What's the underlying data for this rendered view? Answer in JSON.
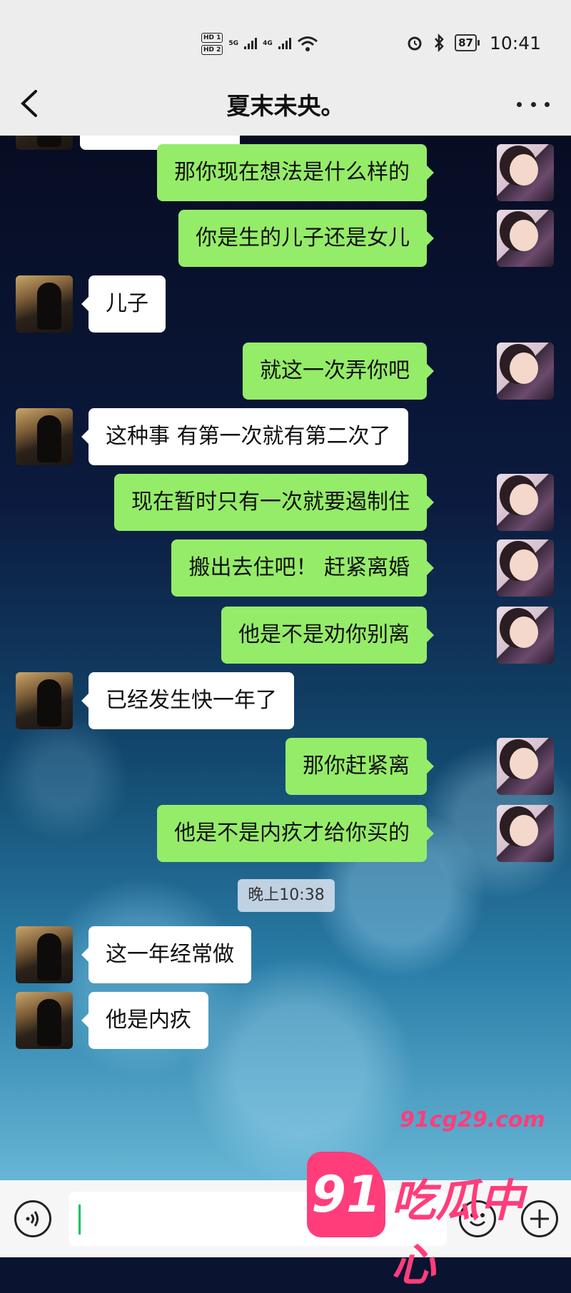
{
  "status_bar": {
    "sim1": "HD 1",
    "sim2": "HD 2",
    "net1": "5G",
    "net2": "4G",
    "battery": "87",
    "time": "10:41"
  },
  "header": {
    "title": "夏末未央。"
  },
  "messages": [
    {
      "side": "self",
      "text": "那你现在想法是什么样的"
    },
    {
      "side": "self",
      "text": "你是生的儿子还是女儿"
    },
    {
      "side": "other",
      "text": "儿子"
    },
    {
      "side": "self",
      "text": "就这一次弄你吧"
    },
    {
      "side": "other",
      "text": "这种事 有第一次就有第二次了"
    },
    {
      "side": "self",
      "text": "现在暂时只有一次就要遏制住"
    },
    {
      "side": "self",
      "text": "搬出去住吧！ 赶紧离婚"
    },
    {
      "side": "self",
      "text": "他是不是劝你别离"
    },
    {
      "side": "other",
      "text": "已经发生快一年了"
    },
    {
      "side": "self",
      "text": "那你赶紧离"
    },
    {
      "side": "self",
      "text": "他是不是内疚才给你买的"
    },
    {
      "side": "other",
      "text": "这一年经常做"
    },
    {
      "side": "other",
      "text": "他是内疚"
    }
  ],
  "timestamp": "晚上10:38",
  "watermark": {
    "url": "91cg29.com",
    "badge": "91",
    "text": "吃瓜中心"
  }
}
